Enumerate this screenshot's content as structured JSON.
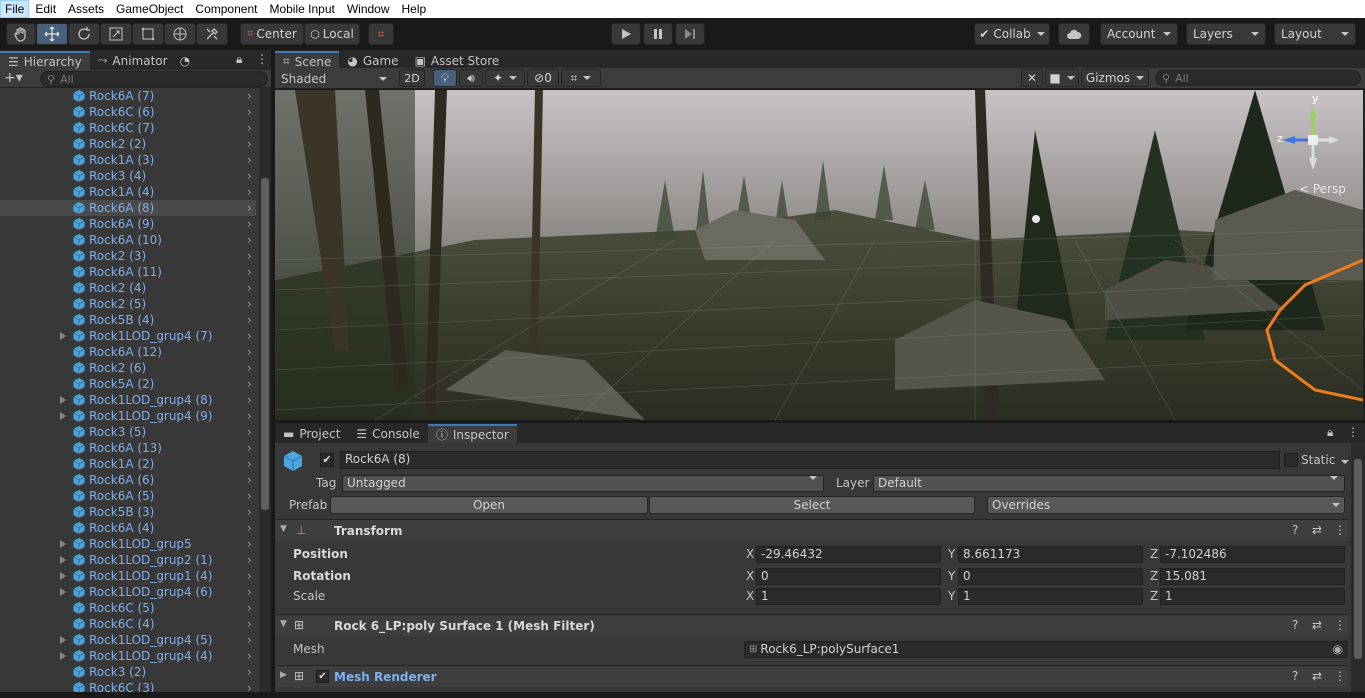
{
  "menu": [
    "File",
    "Edit",
    "Assets",
    "GameObject",
    "Component",
    "Mobile Input",
    "Window",
    "Help"
  ],
  "toolbar": {
    "pivot_label": "Center",
    "space_label": "Local",
    "collab_label": "Collab",
    "account_label": "Account",
    "layers_label": "Layers",
    "layout_label": "Layout"
  },
  "hierarchy": {
    "tabs": [
      "Hierarchy",
      "Animator"
    ],
    "search_placeholder": "All",
    "items": [
      {
        "label": "Rock6A (7)",
        "expandable": false,
        "selected": false
      },
      {
        "label": "Rock6C (6)",
        "expandable": false,
        "selected": false
      },
      {
        "label": "Rock6C (7)",
        "expandable": false,
        "selected": false
      },
      {
        "label": "Rock2 (2)",
        "expandable": false,
        "selected": false
      },
      {
        "label": "Rock1A (3)",
        "expandable": false,
        "selected": false
      },
      {
        "label": "Rock3 (4)",
        "expandable": false,
        "selected": false
      },
      {
        "label": "Rock1A (4)",
        "expandable": false,
        "selected": false
      },
      {
        "label": "Rock6A (8)",
        "expandable": false,
        "selected": true
      },
      {
        "label": "Rock6A (9)",
        "expandable": false,
        "selected": false
      },
      {
        "label": "Rock6A (10)",
        "expandable": false,
        "selected": false
      },
      {
        "label": "Rock2 (3)",
        "expandable": false,
        "selected": false
      },
      {
        "label": "Rock6A (11)",
        "expandable": false,
        "selected": false
      },
      {
        "label": "Rock2 (4)",
        "expandable": false,
        "selected": false
      },
      {
        "label": "Rock2 (5)",
        "expandable": false,
        "selected": false
      },
      {
        "label": "Rock5B (4)",
        "expandable": false,
        "selected": false
      },
      {
        "label": "Rock1LOD_grup4 (7)",
        "expandable": true,
        "selected": false
      },
      {
        "label": "Rock6A (12)",
        "expandable": false,
        "selected": false
      },
      {
        "label": "Rock2 (6)",
        "expandable": false,
        "selected": false
      },
      {
        "label": "Rock5A (2)",
        "expandable": false,
        "selected": false
      },
      {
        "label": "Rock1LOD_grup4 (8)",
        "expandable": true,
        "selected": false
      },
      {
        "label": "Rock1LOD_grup4 (9)",
        "expandable": true,
        "selected": false
      },
      {
        "label": "Rock3 (5)",
        "expandable": false,
        "selected": false
      },
      {
        "label": "Rock6A (13)",
        "expandable": false,
        "selected": false
      },
      {
        "label": "Rock1A (2)",
        "expandable": false,
        "selected": false
      },
      {
        "label": "Rock6A (6)",
        "expandable": false,
        "selected": false
      },
      {
        "label": "Rock6A (5)",
        "expandable": false,
        "selected": false
      },
      {
        "label": "Rock5B (3)",
        "expandable": false,
        "selected": false
      },
      {
        "label": "Rock6A (4)",
        "expandable": false,
        "selected": false
      },
      {
        "label": "Rock1LOD_grup5",
        "expandable": true,
        "selected": false
      },
      {
        "label": "Rock1LOD_grup2 (1)",
        "expandable": true,
        "selected": false
      },
      {
        "label": "Rock1LOD_grup1 (4)",
        "expandable": true,
        "selected": false
      },
      {
        "label": "Rock1LOD_grup4 (6)",
        "expandable": true,
        "selected": false
      },
      {
        "label": "Rock6C (5)",
        "expandable": false,
        "selected": false
      },
      {
        "label": "Rock6C (4)",
        "expandable": false,
        "selected": false
      },
      {
        "label": "Rock1LOD_grup4 (5)",
        "expandable": true,
        "selected": false
      },
      {
        "label": "Rock1LOD_grup4 (4)",
        "expandable": true,
        "selected": false
      },
      {
        "label": "Rock3 (2)",
        "expandable": false,
        "selected": false
      },
      {
        "label": "Rock6C (3)",
        "expandable": false,
        "selected": false
      }
    ]
  },
  "scene": {
    "tabs": [
      "Scene",
      "Game",
      "Asset Store"
    ],
    "shading_mode": "Shaded",
    "two_d_label": "2D",
    "hidden_count": "0",
    "gizmos_label": "Gizmos",
    "search_placeholder": "All",
    "projection_label": "Persp",
    "axis_y": "y",
    "axis_z": "z"
  },
  "inspector": {
    "tabs": [
      "Project",
      "Console",
      "Inspector"
    ],
    "object_name": "Rock6A (8)",
    "active": true,
    "static_label": "Static",
    "tag_label": "Tag",
    "tag_value": "Untagged",
    "layer_label": "Layer",
    "layer_value": "Default",
    "prefab_label": "Prefab",
    "prefab_open": "Open",
    "prefab_select": "Select",
    "prefab_overrides": "Overrides",
    "transform": {
      "title": "Transform",
      "position_label": "Position",
      "rotation_label": "Rotation",
      "scale_label": "Scale",
      "axis_x": "X",
      "axis_y": "Y",
      "axis_z": "Z",
      "position": {
        "x": "-29.46432",
        "y": "8.661173",
        "z": "-7.102486"
      },
      "rotation": {
        "x": "0",
        "y": "0",
        "z": "15.081"
      },
      "scale": {
        "x": "1",
        "y": "1",
        "z": "1"
      }
    },
    "mesh_filter": {
      "title": "Rock 6_LP:poly Surface 1 (Mesh Filter)",
      "mesh_label": "Mesh",
      "mesh_value": "Rock6_LP:polySurface1"
    },
    "mesh_renderer": {
      "title": "Mesh Renderer"
    }
  },
  "colors": {
    "accent": "#3a79bb",
    "link": "#7cb0f3",
    "selection_outline": "#f07d1a"
  }
}
